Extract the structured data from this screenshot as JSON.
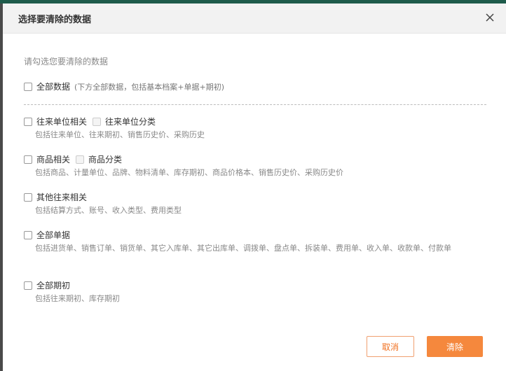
{
  "dialog": {
    "title": "选择要清除的数据",
    "hint": "请勾选您要清除的数据"
  },
  "all_data": {
    "label": "全部数据",
    "note": "(下方全部数据，包括基本档案+单据+期初)"
  },
  "groups": [
    {
      "label": "往来单位相关",
      "sub_label": "往来单位分类",
      "desc": "包括往来单位、往来期初、销售历史价、采购历史"
    },
    {
      "label": "商品相关",
      "sub_label": "商品分类",
      "desc": "包括商品、计量单位、品牌、物料清单、库存期初、商品价格本、销售历史价、采购历史价"
    },
    {
      "label": "其他往来相关",
      "desc": "包括结算方式、账号、收入类型、费用类型"
    },
    {
      "label": "全部单据",
      "desc": "包括进货单、销售订单、销货单、其它入库单、其它出库单、调拨单、盘点单、拆装单、费用单、收入单、收款单、付款单"
    },
    {
      "label": "全部期初",
      "desc": "包括往来期初、库存期初"
    }
  ],
  "buttons": {
    "cancel": "取消",
    "ok": "清除"
  }
}
